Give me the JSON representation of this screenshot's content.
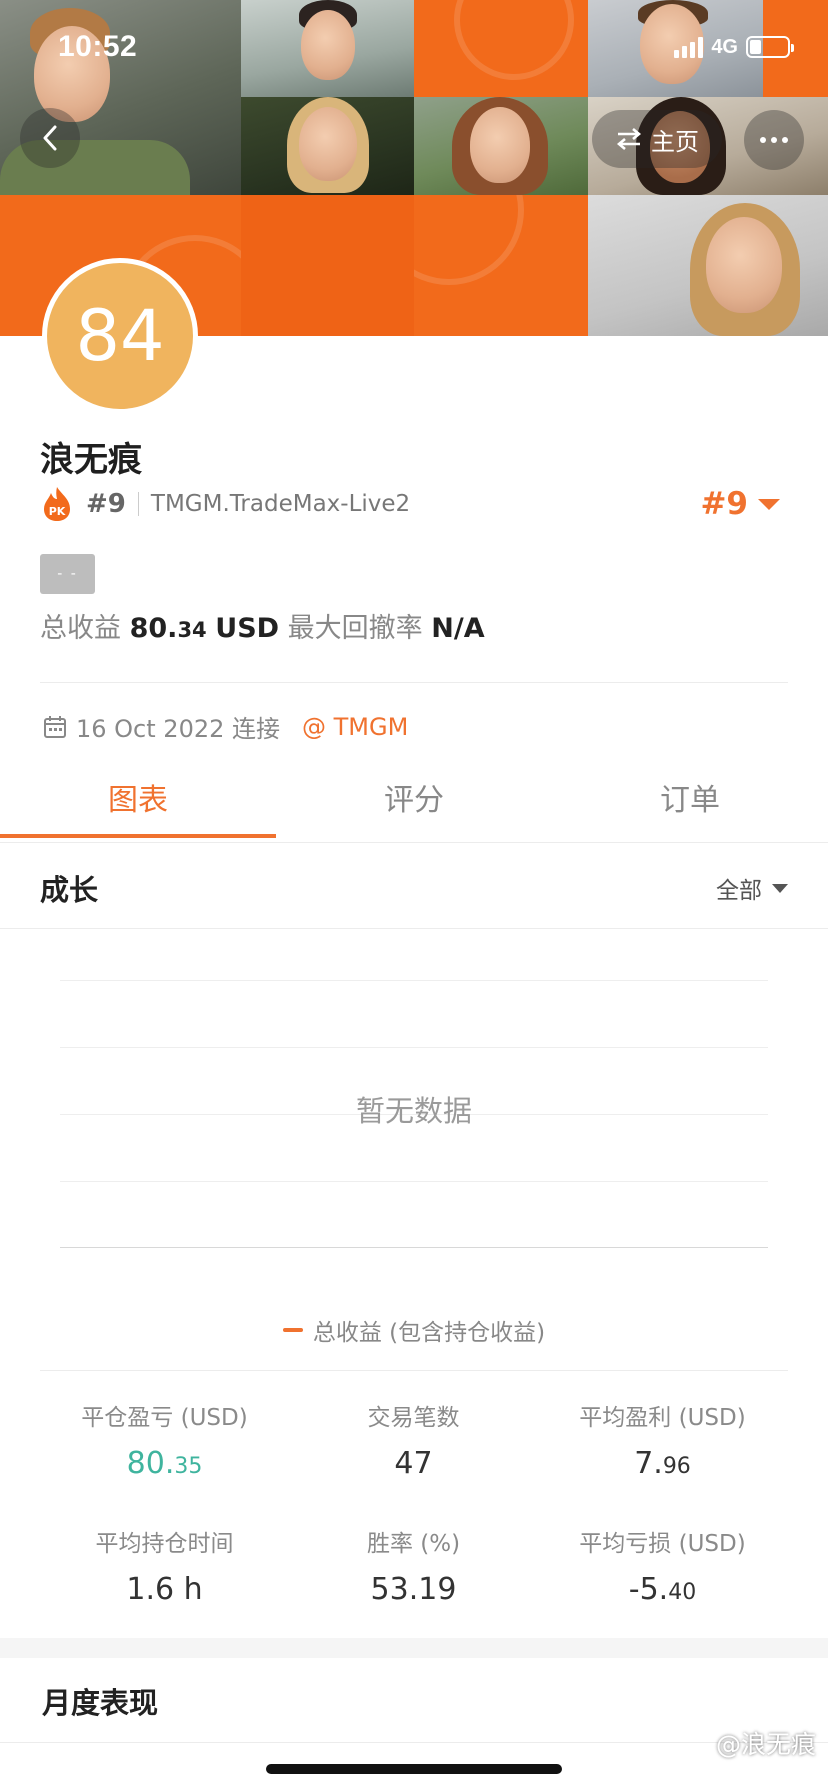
{
  "status_bar": {
    "time": "10:52",
    "network": "4G"
  },
  "header": {
    "home_label": "主页"
  },
  "profile": {
    "score": "84",
    "name": "浪无痕",
    "rank": "#9",
    "server": "TMGM.TradeMax-Live2",
    "rank_right": "#9",
    "tag": "- -",
    "total_profit_label": "总收益",
    "total_profit_int": "80.",
    "total_profit_dec": "34",
    "total_profit_unit": "USD",
    "max_drawdown_label": "最大回撤率",
    "max_drawdown_value": "N/A",
    "connected_text": "16 Oct 2022 连接",
    "broker": "@ TMGM"
  },
  "tabs": [
    {
      "label": "图表",
      "active": true
    },
    {
      "label": "评分",
      "active": false
    },
    {
      "label": "订单",
      "active": false
    }
  ],
  "growth": {
    "title": "成长",
    "range_label": "全部",
    "empty_text": "暂无数据",
    "legend_label": "总收益 (包含持仓收益)"
  },
  "metrics": [
    {
      "label": "平仓盈亏 (USD)",
      "int": "80.",
      "dec": "35"
    },
    {
      "label": "交易笔数",
      "int": "47",
      "dec": ""
    },
    {
      "label": "平均盈利 (USD)",
      "int": "7.",
      "dec": "96"
    },
    {
      "label": "平均持仓时间",
      "int": "1.6 h",
      "dec": ""
    },
    {
      "label": "胜率 (%)",
      "int": "53.19",
      "dec": ""
    },
    {
      "label": "平均亏损 (USD)",
      "int": "-5.",
      "dec": "40"
    }
  ],
  "monthly": {
    "title": "月度表现"
  },
  "watermark": "@浪无痕",
  "colors": {
    "accent": "#f0722f",
    "positive": "#3fb49e",
    "score_badge": "#f0b45e",
    "banner": "#f26a1b"
  }
}
